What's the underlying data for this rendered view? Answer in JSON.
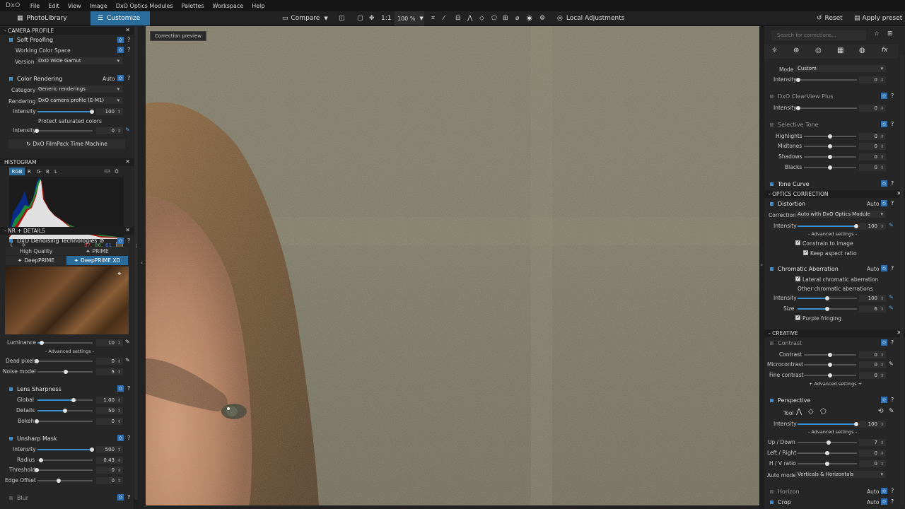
{
  "app": {
    "logo": "DxO"
  },
  "menu": [
    "File",
    "Edit",
    "View",
    "Image",
    "DxO Optics Modules",
    "Palettes",
    "Workspace",
    "Help"
  ],
  "tabs": {
    "photolibrary": "PhotoLibrary",
    "customize": "Customize"
  },
  "toolbar": {
    "compare": "Compare",
    "one_to_one": "1:1",
    "zoom": "100 %",
    "local_adjustments": "Local Adjustments",
    "reset": "Reset",
    "apply_preset": "Apply preset"
  },
  "viewer": {
    "badge": "Correction preview"
  },
  "left": {
    "camera_profile": {
      "title": "- CAMERA PROFILE",
      "soft_proofing": "Soft Proofing",
      "working_color_space": "Working Color Space",
      "version_label": "Version",
      "version_value": "DxO Wide Gamut"
    },
    "color_rendering": {
      "title": "Color Rendering",
      "auto": "Auto",
      "category_label": "Category",
      "category_value": "Generic renderings",
      "rendering_label": "Rendering",
      "rendering_value": "DxO camera profile (E-M1)",
      "intensity_label": "Intensity",
      "intensity_value": "100",
      "intensity_level": 100,
      "protect": "Protect saturated colors",
      "protect_label": "Intensity",
      "protect_value": "0",
      "filmpack": "DxO FilmPack Time Machine"
    },
    "histogram": {
      "title": "HISTOGRAM",
      "channels": [
        "RGB",
        "R",
        "G",
        "B",
        "L"
      ],
      "r": "97,",
      "g": "86,",
      "b": "61"
    },
    "nr": {
      "title": "- NR + DETAILS",
      "denoise": "DxO Denoising Technologies",
      "hq": "High Quality",
      "prime": "PRIME",
      "deepprime": "DeepPRIME",
      "deepprime_xd": "DeepPRIME XD",
      "luminance_label": "Luminance",
      "luminance_value": "10",
      "advanced": "- Advanced settings -",
      "dead_label": "Dead pixels",
      "dead_value": "0",
      "noise_label": "Noise model",
      "noise_value": "5"
    },
    "lens": {
      "title": "Lens Sharpness",
      "global_label": "Global",
      "global_value": "1.00",
      "details_label": "Details",
      "details_value": "50",
      "bokeh_label": "Bokeh",
      "bokeh_value": "0"
    },
    "usm": {
      "title": "Unsharp Mask",
      "intensity_label": "Intensity",
      "intensity_value": "500",
      "radius_label": "Radius",
      "radius_value": "0.43",
      "threshold_label": "Threshold",
      "threshold_value": "0",
      "edge_label": "Edge Offset",
      "edge_value": "0"
    },
    "blur": {
      "title": "Blur"
    }
  },
  "right": {
    "search_placeholder": "Search for corrections...",
    "mode_label": "Mode",
    "mode_value": "Custom",
    "intensity_label": "Intensity",
    "intensity_value": "0",
    "clearview": {
      "title": "DxO ClearView Plus",
      "intensity_label": "Intensity",
      "intensity_value": "0"
    },
    "selective": {
      "title": "Selective Tone",
      "highlights": "Highlights",
      "midtones": "Midtones",
      "shadows": "Shadows",
      "blacks": "Blacks",
      "v1": "0",
      "v2": "0",
      "v3": "0",
      "v4": "0"
    },
    "tone_curve": "Tone Curve",
    "optics": {
      "title": "- OPTICS CORRECTION",
      "distortion": "Distortion",
      "auto": "Auto",
      "correction_label": "Correction",
      "correction_value": "Auto with DxO Optics Module",
      "intensity_label": "Intensity",
      "intensity_value": "100",
      "advanced": "- Advanced settings -",
      "constrain": "Constrain to image",
      "keep_aspect": "Keep aspect ratio"
    },
    "ca": {
      "title": "Chromatic Aberration",
      "auto": "Auto",
      "lateral": "Lateral chromatic aberration",
      "other": "Other chromatic aberrations",
      "intensity_label": "Intensity",
      "intensity_value": "100",
      "size_label": "Size",
      "size_value": "6",
      "purple": "Purple fringing"
    },
    "creative": {
      "title": "- CREATIVE",
      "contrast_group": "Contrast",
      "contrast": "Contrast",
      "microcontrast": "Microcontrast",
      "fine": "Fine contrast",
      "v1": "0",
      "v2": "0",
      "v3": "0",
      "advanced": "+ Advanced settings +"
    },
    "perspective": {
      "title": "Perspective",
      "tool_label": "Tool",
      "intensity_label": "Intensity",
      "intensity_value": "100",
      "advanced": "- Advanced settings -",
      "updown": "Up / Down",
      "updown_value": "7",
      "leftright": "Left / Right",
      "leftright_value": "0",
      "hv": "H / V ratio",
      "hv_value": "0",
      "automode_label": "Auto mode",
      "automode_value": "Verticals & Horizontals"
    },
    "horizon": {
      "title": "Horizon",
      "auto": "Auto"
    },
    "crop": {
      "title": "Crop",
      "auto": "Auto"
    }
  },
  "colors": {
    "accent": "#2a6d9c",
    "star": "#2f6fb0",
    "slider": "#3a8fd0"
  }
}
